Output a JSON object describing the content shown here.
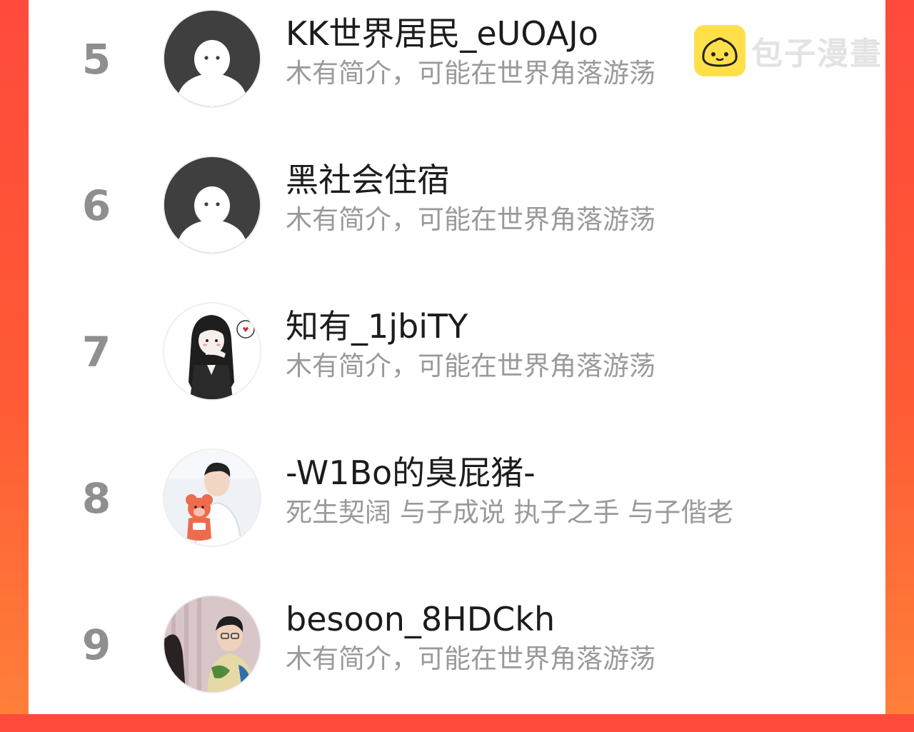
{
  "watermark": {
    "text": "包子漫畫",
    "logo_icon": "bun-logo-icon",
    "logo_color": "#ffe04a"
  },
  "theme": {
    "background_top": "#ff4a3c",
    "background_bottom": "#ff7f3a",
    "rank_color": "#8f8f8f",
    "name_color": "#1c1c1c",
    "bio_color": "#9a9a9a"
  },
  "users": [
    {
      "rank": "5",
      "name": "KK世界居民_eUOAJo",
      "bio": "木有简介，可能在世界角落游荡",
      "avatar": "default-avatar-icon"
    },
    {
      "rank": "6",
      "name": "黑社会住宿",
      "bio": "木有简介，可能在世界角落游荡",
      "avatar": "default-avatar-icon"
    },
    {
      "rank": "7",
      "name": "知有_1jbiTY",
      "bio": "木有简介，可能在世界角落游荡",
      "avatar": "anime-girl-avatar"
    },
    {
      "rank": "8",
      "name": "-W1Bo的臭屁猪-",
      "bio": "死生契阔 与子成说 执子之手 与子偕老",
      "avatar": "photo-avatar-bear"
    },
    {
      "rank": "9",
      "name": "besoon_8HDCkh",
      "bio": "木有简介，可能在世界角落游荡",
      "avatar": "photo-avatar-person"
    }
  ]
}
